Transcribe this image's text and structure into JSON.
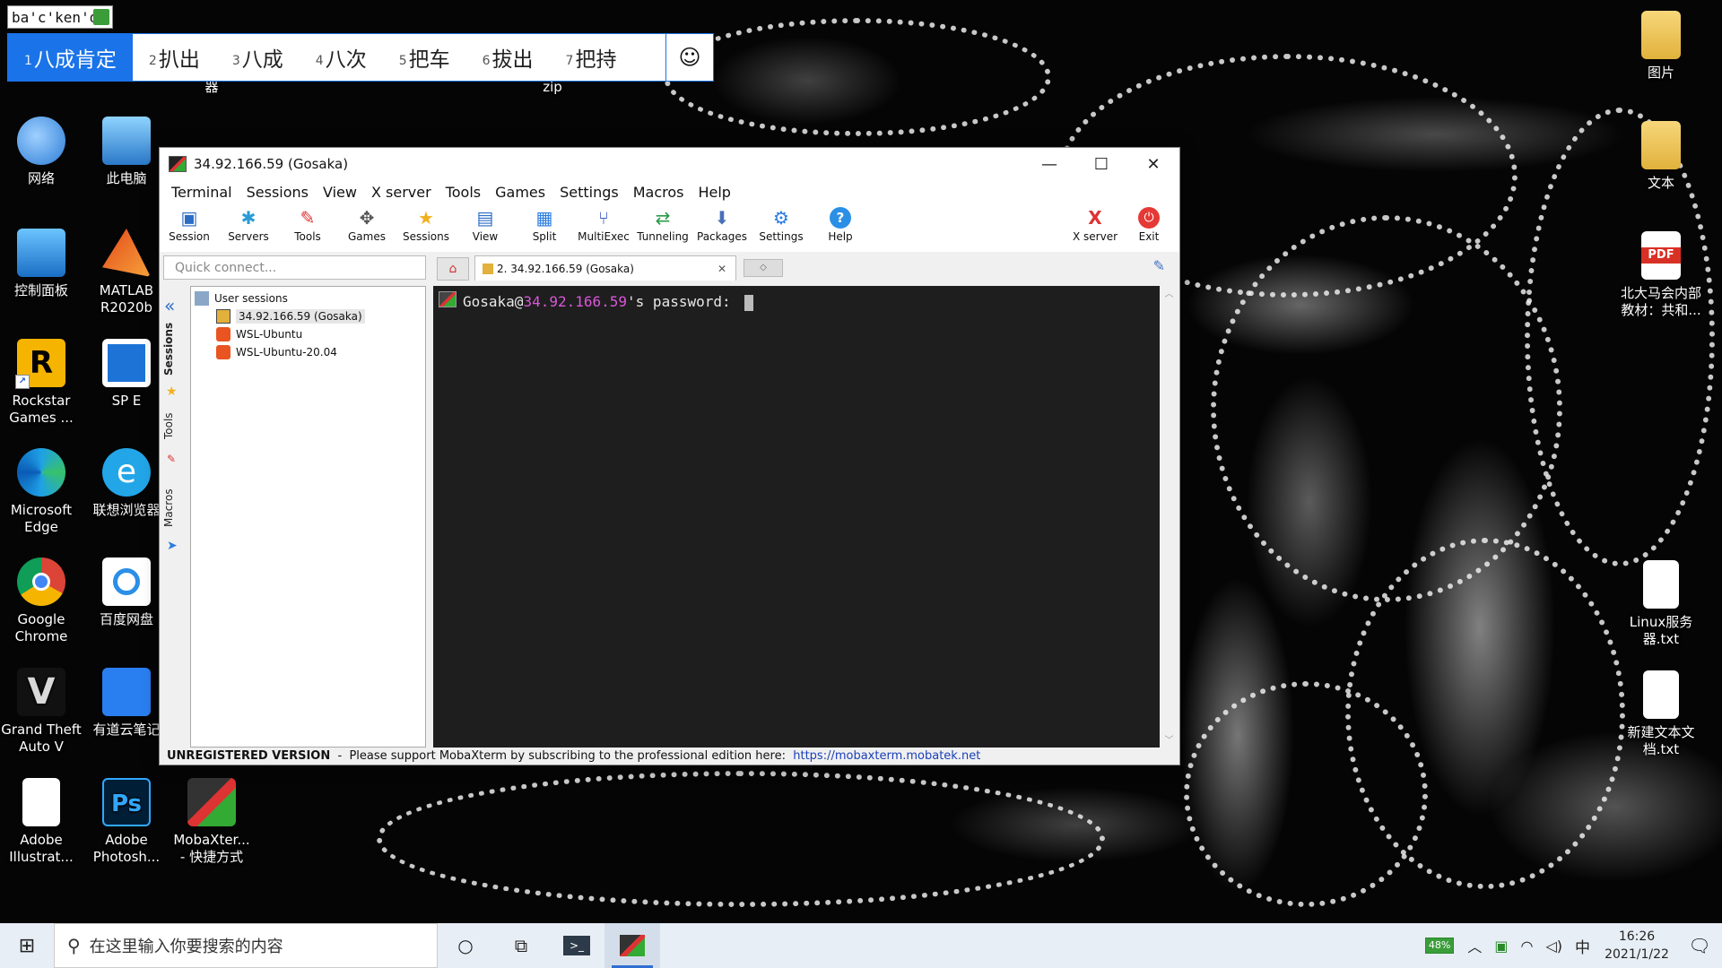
{
  "ime": {
    "input": "ba'c'ken'd",
    "candidates": [
      {
        "num": "1",
        "text": "八成肯定"
      },
      {
        "num": "2",
        "text": "扒出"
      },
      {
        "num": "3",
        "text": "八成"
      },
      {
        "num": "4",
        "text": "八次"
      },
      {
        "num": "5",
        "text": "把车"
      },
      {
        "num": "6",
        "text": "拔出"
      },
      {
        "num": "7",
        "text": "把持"
      }
    ],
    "emoji": "☺"
  },
  "desktop": {
    "left_icons": [
      {
        "label": "网络"
      },
      {
        "label": "此电脑"
      },
      {
        "label": "控制面板"
      },
      {
        "label": "MATLAB R2020b"
      },
      {
        "label": "Rockstar Games ..."
      },
      {
        "label": "SP E"
      },
      {
        "label": "Microsoft Edge"
      },
      {
        "label": "联想浏览器"
      },
      {
        "label": "Google Chrome"
      },
      {
        "label": "百度网盘"
      },
      {
        "label": "Grand Theft Auto V"
      },
      {
        "label": "有道云笔记"
      },
      {
        "label": "Adobe Illustrat..."
      },
      {
        "label": "Adobe Photosh..."
      },
      {
        "label": "MobaXter... - 快捷方式"
      }
    ],
    "top_labels": {
      "partial_1": "器",
      "partial_2": "zip"
    },
    "right_icons": [
      {
        "label": "图片"
      },
      {
        "label": "文本"
      },
      {
        "label": "北大马会内部教材：共和..."
      },
      {
        "label": "Linux服务器.txt"
      },
      {
        "label": "新建文本文档.txt"
      }
    ],
    "pdf_badge": "PDF"
  },
  "window": {
    "title": "34.92.166.59 (Gosaka)",
    "menus": [
      "Terminal",
      "Sessions",
      "View",
      "X server",
      "Tools",
      "Games",
      "Settings",
      "Macros",
      "Help"
    ],
    "toolbar": [
      {
        "label": "Session",
        "icon": "session-icon"
      },
      {
        "label": "Servers",
        "icon": "servers-icon"
      },
      {
        "label": "Tools",
        "icon": "tools-icon"
      },
      {
        "label": "Games",
        "icon": "games-icon"
      },
      {
        "label": "Sessions",
        "icon": "star-icon"
      },
      {
        "label": "View",
        "icon": "view-icon"
      },
      {
        "label": "Split",
        "icon": "split-icon"
      },
      {
        "label": "MultiExec",
        "icon": "multiexec-icon"
      },
      {
        "label": "Tunneling",
        "icon": "tunneling-icon"
      },
      {
        "label": "Packages",
        "icon": "packages-icon"
      },
      {
        "label": "Settings",
        "icon": "settings-icon"
      },
      {
        "label": "Help",
        "icon": "help-icon"
      }
    ],
    "toolbar_right": [
      {
        "label": "X server",
        "icon": "xserver-icon"
      },
      {
        "label": "Exit",
        "icon": "power-icon"
      }
    ],
    "quick_connect_placeholder": "Quick connect...",
    "tab_label": "2. 34.92.166.59 (Gosaka)",
    "side_tabs": [
      "Sessions",
      "Tools",
      "Macros"
    ],
    "tree": {
      "root": "User sessions",
      "items": [
        "34.92.166.59 (Gosaka)",
        "WSL-Ubuntu",
        "WSL-Ubuntu-20.04"
      ]
    },
    "terminal": {
      "user": "Gosaka@",
      "host": "34.92.166.59",
      "suffix": "'s password: "
    },
    "status": {
      "bold": "UNREGISTERED VERSION",
      "text": "  -  Please support MobaXterm by subscribing to the professional edition here:  ",
      "link": "https://mobaxterm.mobatek.net"
    }
  },
  "taskbar": {
    "search_placeholder": "在这里输入你要搜索的内容",
    "battery": "48%",
    "ime_indicator": "中",
    "time": "16:26",
    "date": "2021/1/22"
  }
}
